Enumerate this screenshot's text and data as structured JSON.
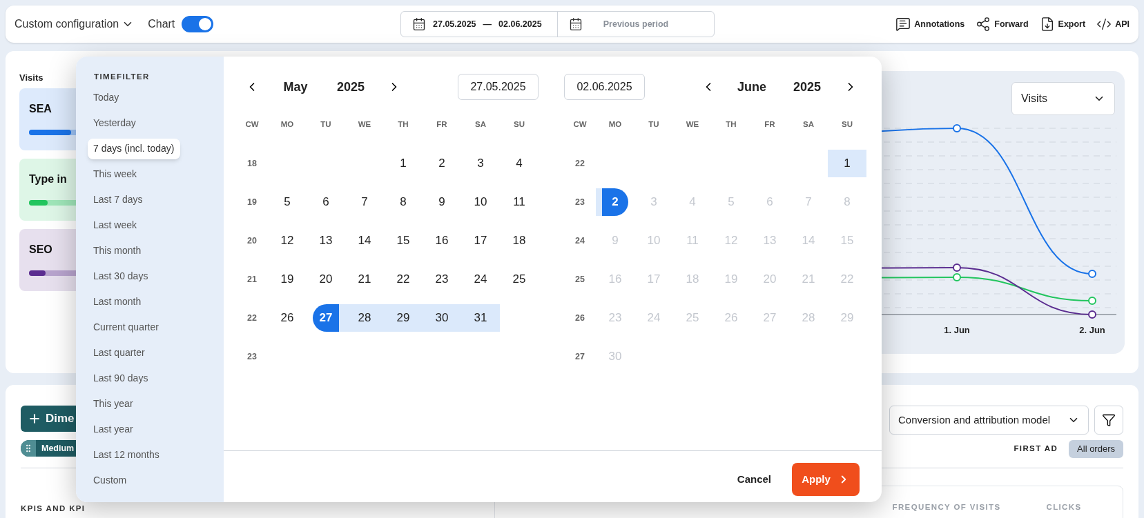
{
  "toolbar": {
    "config": {
      "label": "Custom configuration"
    },
    "chart_toggle": {
      "label": "Chart",
      "on": true
    },
    "date_range": {
      "start": "27.05.2025",
      "separator": "—",
      "end": "02.06.2025"
    },
    "compare": {
      "label": "Previous period"
    },
    "actions": [
      {
        "kind": "annotations",
        "label": "Annotations"
      },
      {
        "kind": "forward",
        "label": "Forward"
      },
      {
        "kind": "export",
        "label": "Export"
      },
      {
        "kind": "api",
        "label": "API"
      }
    ]
  },
  "visits_panel": {
    "title": "Visits",
    "channels": [
      {
        "name": "SEA",
        "color": "#1a73e8",
        "level": 0.9
      },
      {
        "name": "Type in",
        "color": "#22c55e",
        "level": 0.4
      },
      {
        "name": "SEO",
        "color": "#5b2d90",
        "level": 0.35
      }
    ]
  },
  "chart": {
    "metric": "Visits",
    "x_labels": [
      "1. Jun",
      "2. Jun"
    ]
  },
  "table_section": {
    "dimension_button": "Dime",
    "chip": "Medium",
    "kpi_header": "KPIS AND KPI",
    "attribution_select": "Conversion and attribution model",
    "model": "FIRST AD",
    "orders_chip": {
      "label": "All orders",
      "selected": true
    },
    "columns": [
      "FREQUENCY OF VISITS",
      "CLICKS"
    ]
  },
  "timefilter_popup": {
    "title": "TIMEFILTER",
    "presets": [
      {
        "label": "Today",
        "selected": false
      },
      {
        "label": "Yesterday",
        "selected": false
      },
      {
        "label": "7 days (incl. today)",
        "selected": true
      },
      {
        "label": "This week",
        "selected": false
      },
      {
        "label": "Last 7 days",
        "selected": false
      },
      {
        "label": "Last week",
        "selected": false
      },
      {
        "label": "This month",
        "selected": false
      },
      {
        "label": "Last 30 days",
        "selected": false
      },
      {
        "label": "Last month",
        "selected": false
      },
      {
        "label": "Current quarter",
        "selected": false
      },
      {
        "label": "Last quarter",
        "selected": false
      },
      {
        "label": "Last 90 days",
        "selected": false
      },
      {
        "label": "This year",
        "selected": false
      },
      {
        "label": "Last year",
        "selected": false
      },
      {
        "label": "Last 12 months",
        "selected": false
      },
      {
        "label": "Custom",
        "selected": false
      }
    ],
    "months": [
      {
        "name": "May",
        "year": "2025",
        "input": "27.05.2025",
        "weekdays": [
          "CW",
          "MO",
          "TU",
          "WE",
          "TH",
          "FR",
          "SA",
          "SU"
        ],
        "weeks": [
          {
            "cw": "18",
            "days": [
              {
                "label": "1",
                "selected": false,
                "in_range": false,
                "disabled": false
              },
              {
                "label": "2",
                "selected": false,
                "in_range": false,
                "disabled": false
              },
              {
                "label": "3",
                "selected": false,
                "in_range": false,
                "disabled": false
              },
              {
                "label": "4",
                "selected": false,
                "in_range": false,
                "disabled": false
              }
            ]
          },
          {
            "cw": "19",
            "days": [
              {
                "label": "5",
                "selected": false,
                "in_range": false,
                "disabled": false
              },
              {
                "label": "6",
                "selected": false,
                "in_range": false,
                "disabled": false
              },
              {
                "label": "7",
                "selected": false,
                "in_range": false,
                "disabled": false
              },
              {
                "label": "8",
                "selected": false,
                "in_range": false,
                "disabled": false
              },
              {
                "label": "9",
                "selected": false,
                "in_range": false,
                "disabled": false
              },
              {
                "label": "10",
                "selected": false,
                "in_range": false,
                "disabled": false
              },
              {
                "label": "11",
                "selected": false,
                "in_range": false,
                "disabled": false
              }
            ]
          },
          {
            "cw": "20",
            "days": [
              {
                "label": "12",
                "selected": false,
                "in_range": false,
                "disabled": false
              },
              {
                "label": "13",
                "selected": false,
                "in_range": false,
                "disabled": false
              },
              {
                "label": "14",
                "selected": false,
                "in_range": false,
                "disabled": false
              },
              {
                "label": "15",
                "selected": false,
                "in_range": false,
                "disabled": false
              },
              {
                "label": "16",
                "selected": false,
                "in_range": false,
                "disabled": false
              },
              {
                "label": "17",
                "selected": false,
                "in_range": false,
                "disabled": false
              },
              {
                "label": "18",
                "selected": false,
                "in_range": false,
                "disabled": false
              }
            ]
          },
          {
            "cw": "21",
            "days": [
              {
                "label": "19",
                "selected": false,
                "in_range": false,
                "disabled": false
              },
              {
                "label": "20",
                "selected": false,
                "in_range": false,
                "disabled": false
              },
              {
                "label": "21",
                "selected": false,
                "in_range": false,
                "disabled": false
              },
              {
                "label": "22",
                "selected": false,
                "in_range": false,
                "disabled": false
              },
              {
                "label": "23",
                "selected": false,
                "in_range": false,
                "disabled": false
              },
              {
                "label": "24",
                "selected": false,
                "in_range": false,
                "disabled": false
              },
              {
                "label": "25",
                "selected": false,
                "in_range": false,
                "disabled": false
              }
            ]
          },
          {
            "cw": "22",
            "days": [
              {
                "label": "26",
                "selected": false,
                "in_range": false,
                "disabled": false
              },
              {
                "label": "27",
                "selected": true,
                "in_range": false,
                "disabled": false
              },
              {
                "label": "28",
                "selected": false,
                "in_range": true,
                "disabled": false
              },
              {
                "label": "29",
                "selected": false,
                "in_range": true,
                "disabled": false
              },
              {
                "label": "30",
                "selected": false,
                "in_range": true,
                "disabled": false
              },
              {
                "label": "31",
                "selected": false,
                "in_range": true,
                "disabled": false
              }
            ]
          },
          {
            "cw": "23"
          }
        ]
      },
      {
        "name": "June",
        "year": "2025",
        "input": "02.06.2025",
        "weekdays": [
          "CW",
          "MO",
          "TU",
          "WE",
          "TH",
          "FR",
          "SA",
          "SU"
        ],
        "weeks": [
          {
            "cw": "22",
            "days": [
              {
                "label": "1",
                "selected": false,
                "in_range": true,
                "disabled": false
              }
            ]
          },
          {
            "cw": "23",
            "days": [
              {
                "label": "2",
                "selected": true,
                "in_range": false,
                "disabled": false
              },
              {
                "label": "3",
                "selected": false,
                "in_range": false,
                "disabled": true
              },
              {
                "label": "4",
                "selected": false,
                "in_range": false,
                "disabled": true
              },
              {
                "label": "5",
                "selected": false,
                "in_range": false,
                "disabled": true
              },
              {
                "label": "6",
                "selected": false,
                "in_range": false,
                "disabled": true
              },
              {
                "label": "7",
                "selected": false,
                "in_range": false,
                "disabled": true
              },
              {
                "label": "8",
                "selected": false,
                "in_range": false,
                "disabled": true
              }
            ]
          },
          {
            "cw": "24",
            "days": [
              {
                "label": "9",
                "selected": false,
                "in_range": false,
                "disabled": true
              },
              {
                "label": "10",
                "selected": false,
                "in_range": false,
                "disabled": true
              },
              {
                "label": "11",
                "selected": false,
                "in_range": false,
                "disabled": true
              },
              {
                "label": "12",
                "selected": false,
                "in_range": false,
                "disabled": true
              },
              {
                "label": "13",
                "selected": false,
                "in_range": false,
                "disabled": true
              },
              {
                "label": "14",
                "selected": false,
                "in_range": false,
                "disabled": true
              },
              {
                "label": "15",
                "selected": false,
                "in_range": false,
                "disabled": true
              }
            ]
          },
          {
            "cw": "25",
            "days": [
              {
                "label": "16",
                "selected": false,
                "in_range": false,
                "disabled": true
              },
              {
                "label": "17",
                "selected": false,
                "in_range": false,
                "disabled": true
              },
              {
                "label": "18",
                "selected": false,
                "in_range": false,
                "disabled": true
              },
              {
                "label": "19",
                "selected": false,
                "in_range": false,
                "disabled": true
              },
              {
                "label": "20",
                "selected": false,
                "in_range": false,
                "disabled": true
              },
              {
                "label": "21",
                "selected": false,
                "in_range": false,
                "disabled": true
              },
              {
                "label": "22",
                "selected": false,
                "in_range": false,
                "disabled": true
              }
            ]
          },
          {
            "cw": "26",
            "days": [
              {
                "label": "23",
                "selected": false,
                "in_range": false,
                "disabled": true
              },
              {
                "label": "24",
                "selected": false,
                "in_range": false,
                "disabled": true
              },
              {
                "label": "25",
                "selected": false,
                "in_range": false,
                "disabled": true
              },
              {
                "label": "26",
                "selected": false,
                "in_range": false,
                "disabled": true
              },
              {
                "label": "27",
                "selected": false,
                "in_range": false,
                "disabled": true
              },
              {
                "label": "28",
                "selected": false,
                "in_range": false,
                "disabled": true
              },
              {
                "label": "29",
                "selected": false,
                "in_range": false,
                "disabled": true
              }
            ]
          },
          {
            "cw": "27",
            "days": [
              {
                "label": "30",
                "selected": false,
                "in_range": false,
                "disabled": true
              }
            ]
          }
        ]
      }
    ],
    "cancel": "Cancel",
    "apply": "Apply"
  }
}
